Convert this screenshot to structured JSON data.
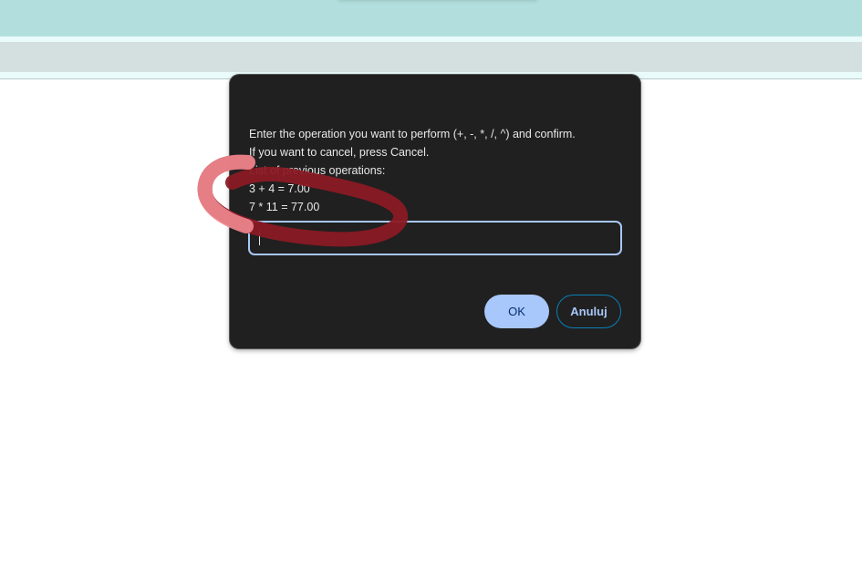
{
  "dialog": {
    "message_lines": [
      "Enter the operation you want to perform (+, -, *, /, ^) and confirm.",
      "If you want to cancel, press Cancel.",
      "List of previous operations:",
      "3 + 4 = 7.00",
      "7 * 11 = 77.00"
    ],
    "input_value": "",
    "ok_label": "OK",
    "cancel_label": "Anuluj"
  },
  "colors": {
    "accent": "#a8c7fa",
    "dialog_bg": "#202020",
    "annotation": "#8a1a24",
    "header": "#b2dfdd"
  }
}
